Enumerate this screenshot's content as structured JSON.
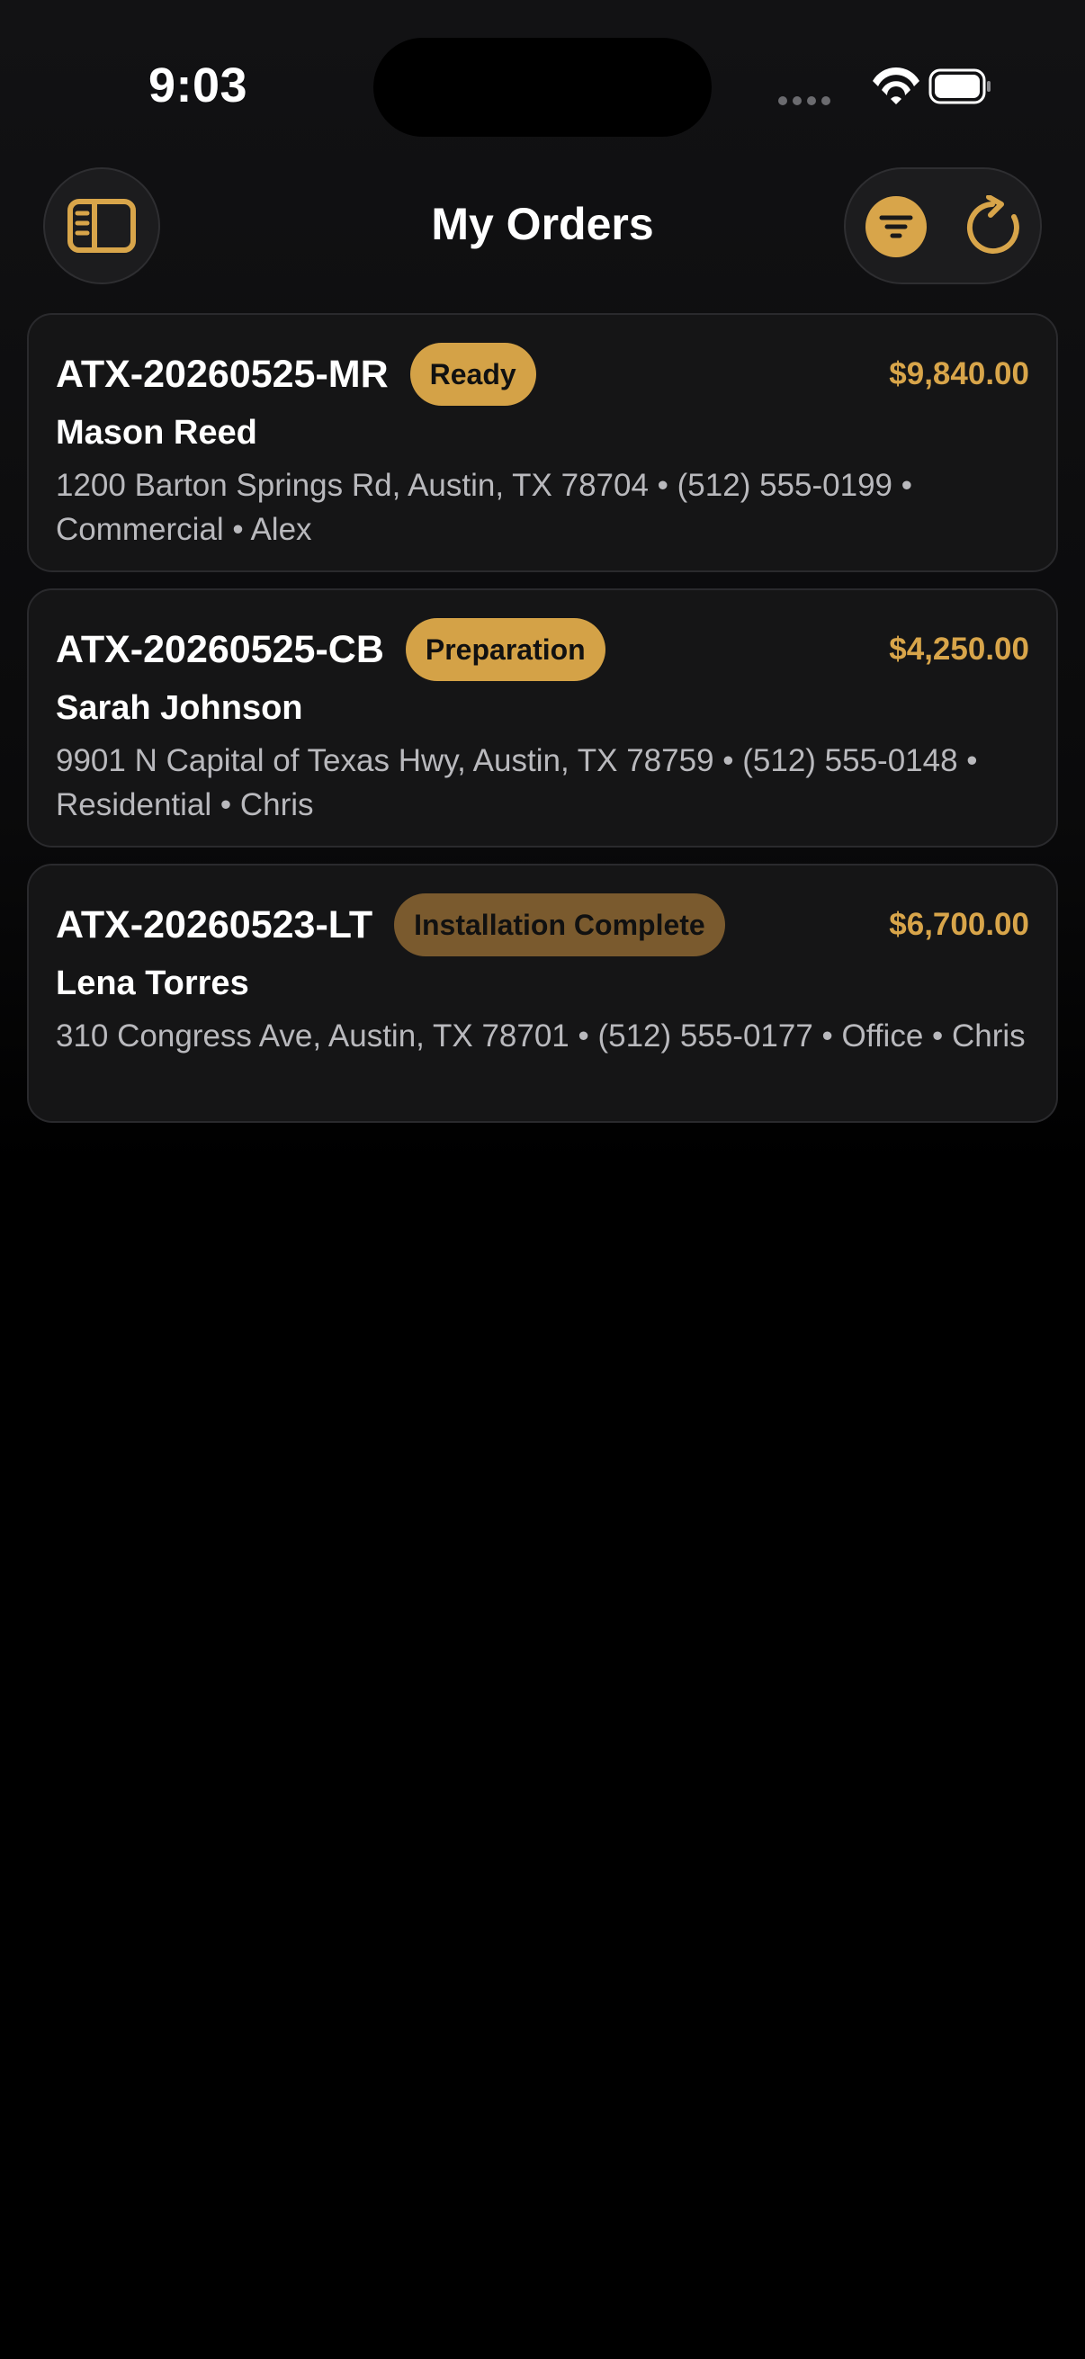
{
  "status_bar": {
    "time": "9:03"
  },
  "header": {
    "title": "My Orders",
    "icons": {
      "sidebar": "sidebar-icon",
      "filter": "filter-icon",
      "refresh": "refresh-icon"
    }
  },
  "colors": {
    "accent": "#d8a54a",
    "badge_gold": "#d4a247",
    "badge_brown": "#7a5a2e",
    "card_bg": "#151516"
  },
  "orders": [
    {
      "id": "ATX-20260525-MR",
      "status": "Ready",
      "amount": "$9,840.00",
      "customer": "Mason Reed",
      "details": "1200 Barton Springs Rd, Austin, TX 78704 • (512) 555-0199 • Commercial • Alex"
    },
    {
      "id": "ATX-20260525-CB",
      "status": "Preparation",
      "amount": "$4,250.00",
      "customer": "Sarah Johnson",
      "details": "9901 N Capital of Texas Hwy, Austin, TX 78759 • (512) 555-0148 • Residential • Chris"
    },
    {
      "id": "ATX-20260523-LT",
      "status": "Installation Complete",
      "amount": "$6,700.00",
      "customer": "Lena Torres",
      "details": "310 Congress Ave, Austin, TX 78701 • (512) 555-0177 • Office • Chris"
    }
  ]
}
